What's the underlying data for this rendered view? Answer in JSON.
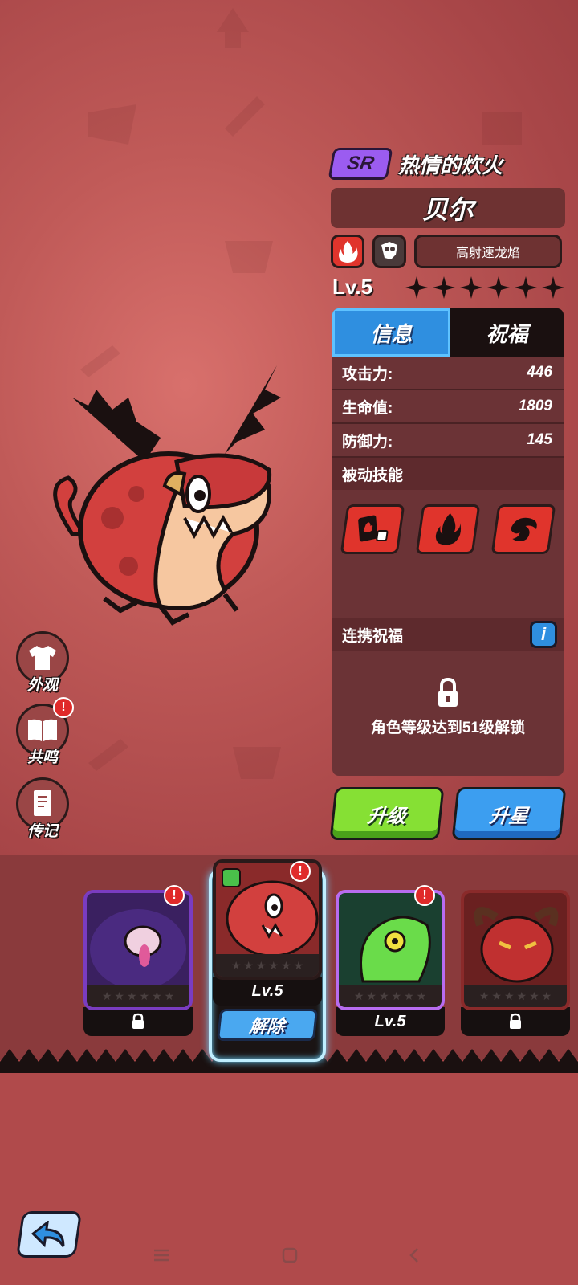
{
  "header": {
    "rarity": "SR",
    "title": "热情的炊火",
    "name": "贝尔",
    "skill_name": "高射速龙焰",
    "level": "Lv.5",
    "stars_total": 6,
    "stars_filled": 0
  },
  "tabs": [
    {
      "label": "信息",
      "active": true
    },
    {
      "label": "祝福",
      "active": false
    }
  ],
  "stats": [
    {
      "label": "攻击力:",
      "value": "446"
    },
    {
      "label": "生命值:",
      "value": "1809"
    },
    {
      "label": "防御力:",
      "value": "145"
    }
  ],
  "passive": {
    "title": "被动技能",
    "icons": [
      "cards-dice-icon",
      "flame-icon",
      "fire-swirl-icon"
    ]
  },
  "bond": {
    "title": "连携祝福",
    "info_label": "i",
    "lock_text": "角色等级达到51级解锁"
  },
  "actions": {
    "upgrade": "升级",
    "star_up": "升星"
  },
  "side_menu": [
    {
      "label": "外观",
      "icon": "shirt-icon",
      "badge": false
    },
    {
      "label": "共鸣",
      "icon": "book-icon",
      "badge": true
    },
    {
      "label": "传记",
      "icon": "journal-icon",
      "badge": false
    }
  ],
  "roster": [
    {
      "name": "purple-beast",
      "footer": "",
      "locked": true,
      "badge": true,
      "frame": "#7a3cc0"
    },
    {
      "name": "bell-dragon",
      "footer": "Lv.5",
      "locked": false,
      "badge": true,
      "selected": true,
      "release": "解除"
    },
    {
      "name": "green-slug",
      "footer": "Lv.5",
      "locked": false,
      "badge": true,
      "frame": "#b86cf0"
    },
    {
      "name": "horned-demon",
      "footer": "",
      "locked": true,
      "badge": false,
      "frame": "#8a2a2a"
    }
  ],
  "colors": {
    "fire": "#e0342c",
    "sr_purple": "#9b5cf0",
    "tab_blue": "#2f8fe0",
    "upgrade_green": "#86e034",
    "star_blue": "#3c9ef0"
  }
}
